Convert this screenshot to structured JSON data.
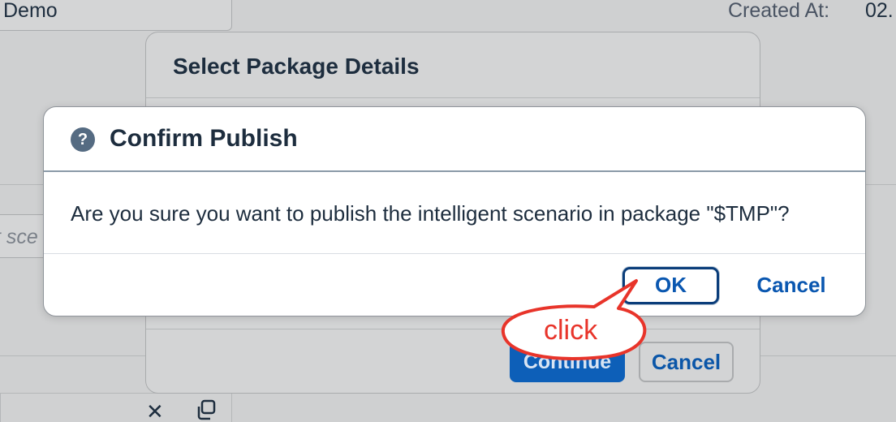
{
  "background": {
    "name_field_value": "Demo",
    "created_at_label": "Created At:",
    "created_at_value": "02.",
    "description_placeholder": "t sce"
  },
  "package_dialog": {
    "title": "Select Package Details",
    "continue_label": "Continue",
    "cancel_label": "Cancel"
  },
  "confirm_dialog": {
    "icon": "question-icon",
    "title": "Confirm Publish",
    "message": "Are you sure you want to publish the intelligent scenario in package \"$TMP\"?",
    "ok_label": "OK",
    "cancel_label": "Cancel"
  },
  "annotation": {
    "callout_text": "click",
    "color": "#e8342a"
  },
  "colors": {
    "accent": "#0a57b0",
    "primary_button": "#0d5fb8",
    "overlay": "#cfd0d1"
  }
}
